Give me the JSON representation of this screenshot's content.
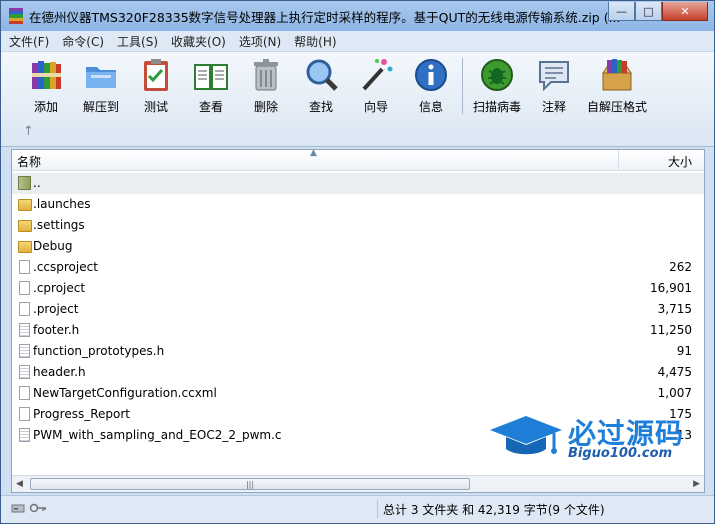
{
  "window": {
    "title": "在德州仪器TMS320F28335数字信号处理器上执行定时采样的程序。基于QUT的无线电源传输系统.zip (...",
    "minimize_glyph": "—",
    "maximize_glyph": "□",
    "close_glyph": "✕"
  },
  "menu": [
    "文件(F)",
    "命令(C)",
    "工具(S)",
    "收藏夹(O)",
    "选项(N)",
    "帮助(H)"
  ],
  "toolbar": [
    {
      "label": "添加",
      "icon": "books-add-icon"
    },
    {
      "label": "解压到",
      "icon": "folder-extract-icon"
    },
    {
      "label": "测试",
      "icon": "clipboard-check-icon"
    },
    {
      "label": "查看",
      "icon": "open-book-icon"
    },
    {
      "label": "删除",
      "icon": "trash-can-icon"
    },
    {
      "label": "查找",
      "icon": "magnifier-icon"
    },
    {
      "label": "向导",
      "icon": "magic-wand-icon"
    },
    {
      "label": "信息",
      "icon": "info-icon"
    },
    {
      "label": "扫描病毒",
      "icon": "virus-scan-icon"
    },
    {
      "label": "注释",
      "icon": "comment-icon"
    },
    {
      "label": "自解压格式",
      "icon": "sfx-box-icon"
    }
  ],
  "up_arrow": "↑",
  "columns": {
    "name": "名称",
    "size": "大小"
  },
  "files": [
    {
      "name": "..",
      "size": "",
      "type": "up"
    },
    {
      "name": ".launches",
      "size": "",
      "type": "folder"
    },
    {
      "name": ".settings",
      "size": "",
      "type": "folder"
    },
    {
      "name": "Debug",
      "size": "",
      "type": "folder"
    },
    {
      "name": ".ccsproject",
      "size": "262",
      "type": "doc"
    },
    {
      "name": ".cproject",
      "size": "16,901",
      "type": "doc"
    },
    {
      "name": ".project",
      "size": "3,715",
      "type": "doc"
    },
    {
      "name": "footer.h",
      "size": "11,250",
      "type": "lines"
    },
    {
      "name": "function_prototypes.h",
      "size": "91",
      "type": "lines"
    },
    {
      "name": "header.h",
      "size": "4,475",
      "type": "lines"
    },
    {
      "name": "NewTargetConfiguration.ccxml",
      "size": "1,007",
      "type": "doc"
    },
    {
      "name": "Progress_Report",
      "size": "175",
      "type": "doc"
    },
    {
      "name": "PWM_with_sampling_and_EOC2_2_pwm.c",
      "size": "13",
      "type": "lines"
    }
  ],
  "scroll": {
    "left": "◀",
    "right": "▶",
    "grip": "|||"
  },
  "status": {
    "text": "总计 3 文件夹 和 42,319 字节(9 个文件)"
  },
  "watermark": {
    "text": "必过源码",
    "url": "Biguo100.com"
  },
  "colors": {
    "accent": "#1f7fd8",
    "titlebar": "#9fc1ea"
  }
}
